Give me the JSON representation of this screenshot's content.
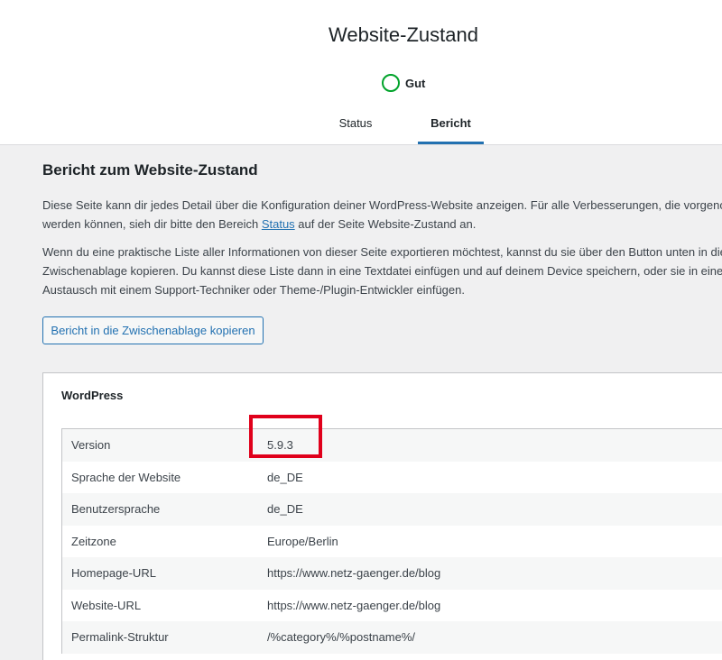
{
  "header": {
    "title": "Website-Zustand",
    "status_label": "Gut",
    "status_color": "#00a32a",
    "tabs": [
      {
        "label": "Status",
        "active": false
      },
      {
        "label": "Bericht",
        "active": true
      }
    ]
  },
  "report": {
    "heading": "Bericht zum Website-Zustand",
    "para1_line1": "Diese Seite kann dir jedes Detail über die Konfiguration deiner WordPress-Website anzeigen. Für alle Verbesserungen, die vorgenom",
    "para1_line2_before": "werden können, sieh dir bitte den Bereich ",
    "para1_link": "Status",
    "para1_line2_after": " auf der Seite Website-Zustand an.",
    "para2_line1": "Wenn du eine praktische Liste aller Informationen von dieser Seite exportieren möchtest, kannst du sie über den Button unten in die",
    "para2_line2": "Zwischenablage kopieren. Du kannst diese Liste dann in eine Textdatei einfügen und auf deinem Device speichern, oder sie in einen",
    "para2_line3": "Austausch mit einem Support-Techniker oder Theme-/Plugin-Entwickler einfügen.",
    "copy_button": "Bericht in die Zwischenablage kopieren"
  },
  "wordpress_panel": {
    "title": "WordPress",
    "rows": [
      {
        "label": "Version",
        "value": "5.9.3"
      },
      {
        "label": "Sprache der Website",
        "value": "de_DE"
      },
      {
        "label": "Benutzersprache",
        "value": "de_DE"
      },
      {
        "label": "Zeitzone",
        "value": "Europe/Berlin"
      },
      {
        "label": "Homepage-URL",
        "value": "https://www.netz-gaenger.de/blog"
      },
      {
        "label": "Website-URL",
        "value": "https://www.netz-gaenger.de/blog"
      },
      {
        "label": "Permalink-Struktur",
        "value": "/%category%/%postname%/"
      }
    ]
  },
  "colors": {
    "accent": "#2271b1",
    "highlight": "#e0001b"
  }
}
